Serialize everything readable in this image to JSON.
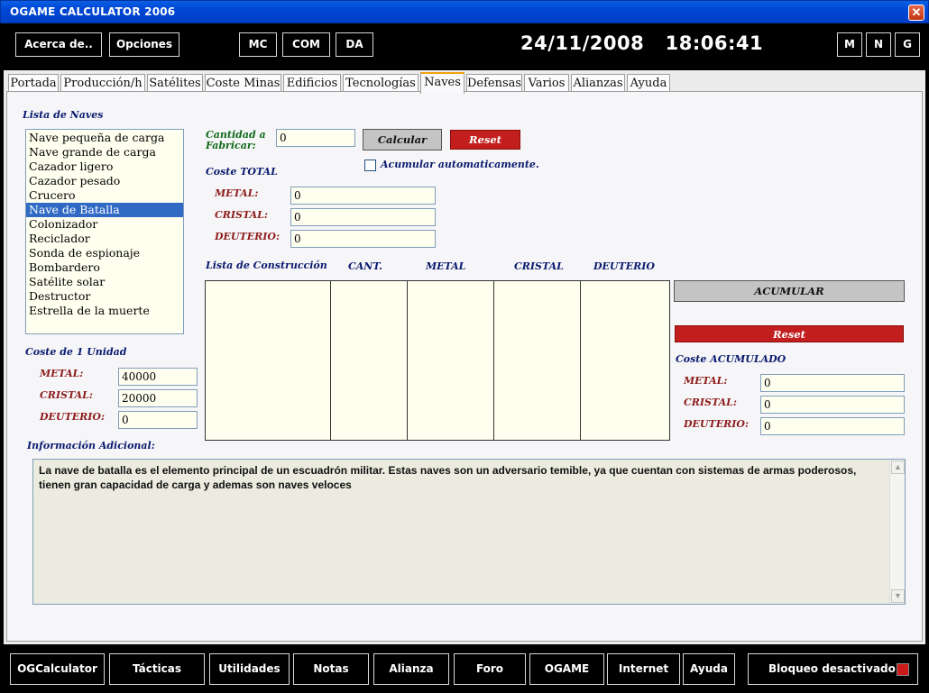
{
  "window": {
    "title": "OGAME CALCULATOR 2006",
    "close_glyph": "✕"
  },
  "header": {
    "about_label": "Acerca de..",
    "options_label": "Opciones",
    "mc_label": "MC",
    "com_label": "COM",
    "da_label": "DA",
    "date": "24/11/2008",
    "time": "18:06:41",
    "m_label": "M",
    "n_label": "N",
    "g_label": "G"
  },
  "tabs": [
    "Portada",
    "Producción/h",
    "Satélites",
    "Coste Minas",
    "Edificios",
    "Tecnologías",
    "Naves",
    "Defensas",
    "Varios",
    "Alianzas",
    "Ayuda"
  ],
  "active_tab": "Naves",
  "ships": {
    "header": "Lista de Naves",
    "items": [
      "Nave pequeña de carga",
      "Nave grande de carga",
      "Cazador ligero",
      "Cazador pesado",
      "Crucero",
      "Nave de Batalla",
      "Colonizador",
      "Reciclador",
      "Sonda de espionaje",
      "Bombardero",
      "Satélite solar",
      "Destructor",
      "Estrella de la muerte"
    ],
    "selected": "Nave de Batalla"
  },
  "unit_cost": {
    "header": "Coste de 1 Unidad",
    "metal_label": "METAL:",
    "metal": "40000",
    "crystal_label": "CRISTAL:",
    "crystal": "20000",
    "deut_label": "DEUTERIO:",
    "deut": "0"
  },
  "quantity": {
    "label_line1": "Cantidad a",
    "label_line2": "Fabricar:",
    "value": "0"
  },
  "buttons": {
    "calculate": "Calcular",
    "reset": "Reset",
    "accumulate": "ACUMULAR",
    "reset2": "Reset"
  },
  "auto_accumulate": {
    "label": "Acumular automaticamente.",
    "checked": false
  },
  "total_cost": {
    "header": "Coste TOTAL",
    "metal_label": "METAL:",
    "metal": "0",
    "crystal_label": "CRISTAL:",
    "crystal": "0",
    "deut_label": "DEUTERIO:",
    "deut": "0"
  },
  "build_list": {
    "header": "Lista de Construcción",
    "col_qty": "CANT.",
    "col_metal": "METAL",
    "col_crystal": "CRISTAL",
    "col_deut": "DEUTERIO"
  },
  "accumulated": {
    "header": "Coste ACUMULADO",
    "metal_label": "METAL:",
    "metal": "0",
    "crystal_label": "CRISTAL:",
    "crystal": "0",
    "deut_label": "DEUTERIO:",
    "deut": "0"
  },
  "info": {
    "header": "Información Adicional:",
    "text": "La nave de batalla es el elemento principal de un escuadrón militar. Estas naves son un adversario temible, ya que cuentan con sistemas de armas poderosos, tienen gran capacidad de carga y ademas son naves veloces"
  },
  "footer": {
    "items": [
      "OGCalculator",
      "Tácticas",
      "Utilidades",
      "Notas",
      "Alianza",
      "Foro",
      "OGAME",
      "Internet",
      "Ayuda"
    ],
    "lock_label": "Bloqueo desactivado",
    "lock_color": "#cc1a1a"
  },
  "colors": {
    "title_bar": "#0046d5",
    "selection": "#316ac5",
    "reset_red": "#c21e1e",
    "active_tab_accent": "#f2a010"
  }
}
